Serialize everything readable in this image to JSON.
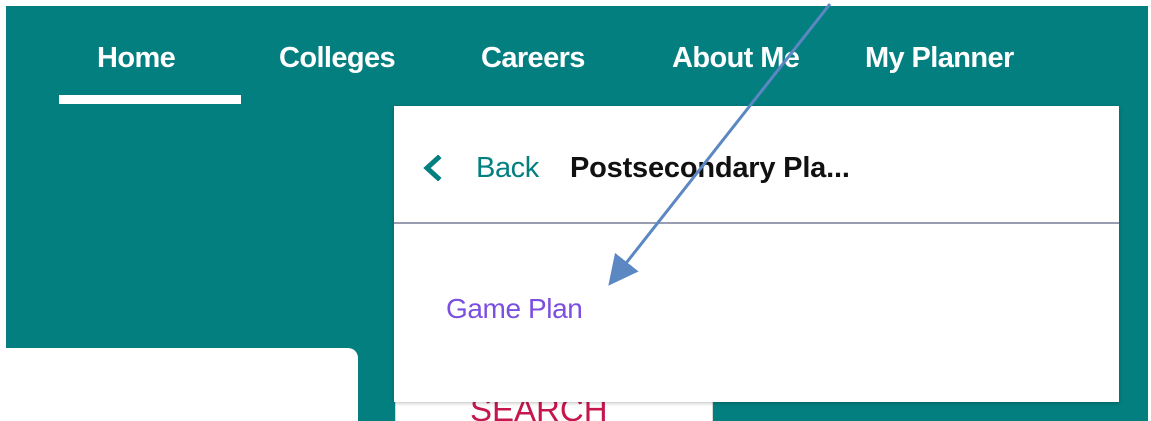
{
  "nav": {
    "items": [
      {
        "label": "Home"
      },
      {
        "label": "Colleges"
      },
      {
        "label": "Careers"
      },
      {
        "label": "About Me"
      },
      {
        "label": "My Planner"
      }
    ],
    "active": "Home"
  },
  "dropdown": {
    "back_label": "Back",
    "title": "Postsecondary Pla...",
    "items": [
      {
        "label": "Game Plan"
      }
    ]
  },
  "background_card": {
    "search_label": "SEARCH"
  },
  "colors": {
    "teal": "#037f80",
    "link_purple": "#7b4fe0",
    "search_red": "#c6174d",
    "arrow_blue": "#5b87c2"
  },
  "icons": {
    "back": "chevron-left-icon",
    "annotation": "arrow-annotation"
  }
}
